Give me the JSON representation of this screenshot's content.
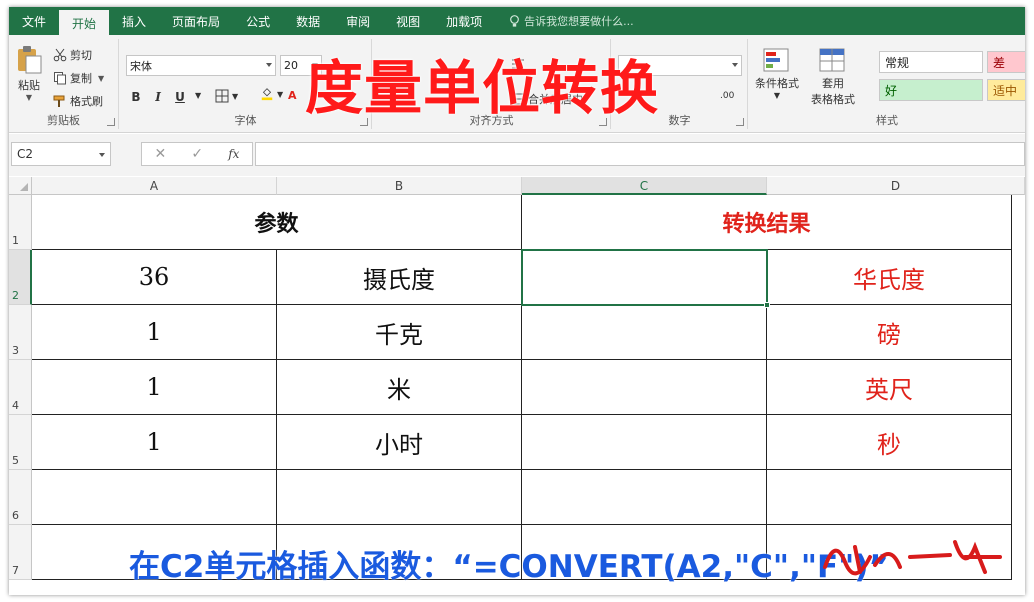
{
  "ribbon": {
    "tabs": [
      "文件",
      "开始",
      "插入",
      "页面布局",
      "公式",
      "数据",
      "审阅",
      "视图",
      "加载项"
    ],
    "active_tab": "开始",
    "tell_me": "告诉我您想要做什么...",
    "clipboard": {
      "paste": "粘贴",
      "cut": "剪切",
      "copy": "复制",
      "format_painter": "格式刷",
      "label": "剪贴板"
    },
    "font": {
      "name": "宋体",
      "size": "20",
      "bold": "B",
      "italic": "I",
      "underline": "U",
      "label": "字体"
    },
    "alignment": {
      "label": "对齐方式",
      "merge": "合并后居中"
    },
    "number": {
      "label": "数字",
      "decimal": ".00"
    },
    "styles": {
      "conditional": "条件格式",
      "table_line1": "套用",
      "table_line2": "表格格式",
      "normal": "常规",
      "bad": "差",
      "good": "好",
      "neutral": "适中",
      "label": "样式"
    }
  },
  "overlay_title": "度量单位转换",
  "formula_bar": {
    "name_box": "C2",
    "cancel": "✕",
    "enter": "✓",
    "fx": "fx",
    "value": ""
  },
  "sheet": {
    "columns": [
      "A",
      "B",
      "C",
      "D"
    ],
    "selected_column": "C",
    "rows": [
      "1",
      "2",
      "3",
      "4",
      "5",
      "6",
      "7"
    ],
    "selected_row": "2",
    "header": {
      "params": "参数",
      "result": "转换结果"
    },
    "data": [
      {
        "value": "36",
        "from": "摄氏度",
        "converted": "",
        "to": "华氏度"
      },
      {
        "value": "1",
        "from": "千克",
        "converted": "",
        "to": "磅"
      },
      {
        "value": "1",
        "from": "米",
        "converted": "",
        "to": "英尺"
      },
      {
        "value": "1",
        "from": "小时",
        "converted": "",
        "to": "秒"
      }
    ]
  },
  "caption": "在C2单元格插入函数：“=CONVERT(A2,\"C\",\"F\")”",
  "colors": {
    "excel_green": "#217346",
    "title_red": "#ff1a1a",
    "result_red": "#e0231b",
    "caption_blue": "#1a5adf"
  }
}
